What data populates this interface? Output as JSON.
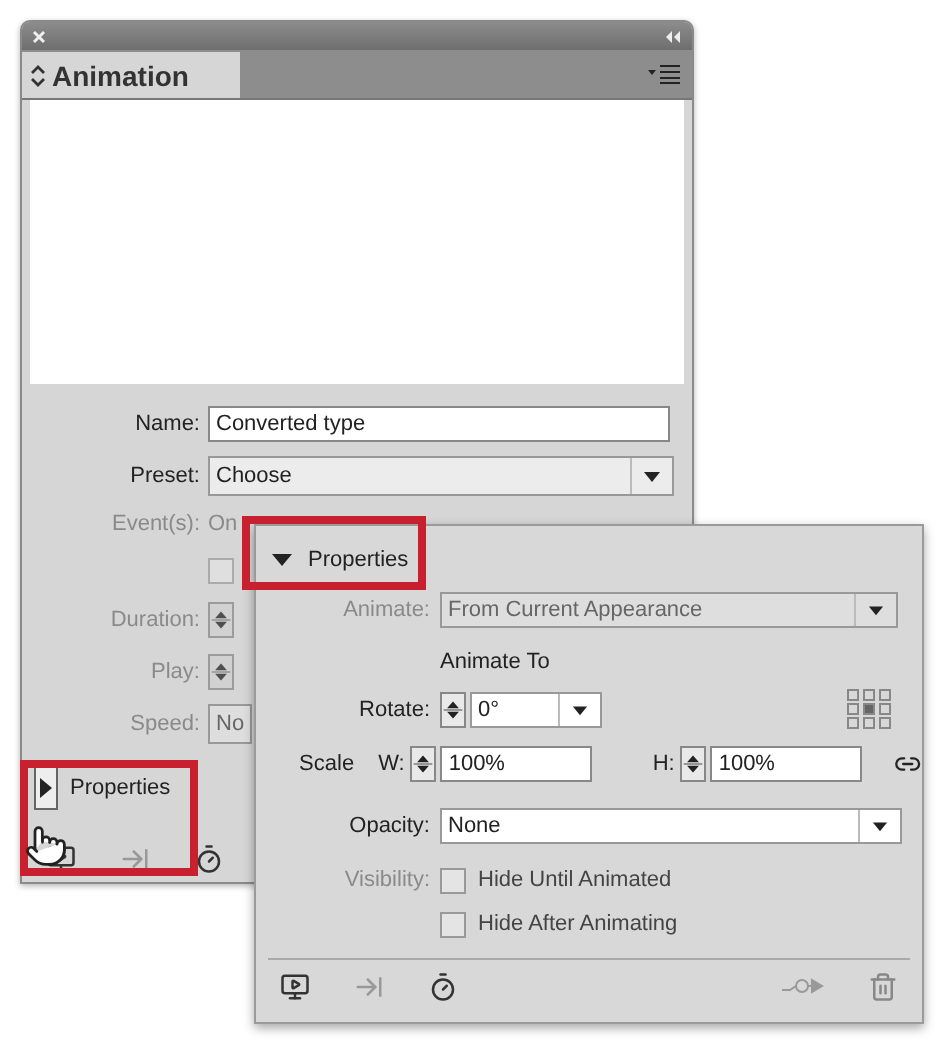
{
  "panel": {
    "title": "Animation",
    "fields": [
      {
        "kind": "text",
        "label": "Name:",
        "value": "Converted type",
        "disabled": false
      },
      {
        "kind": "select",
        "label": "Preset:",
        "value": "Choose",
        "disabled": false
      },
      {
        "kind": "plain",
        "label": "Event(s):",
        "value": "On",
        "disabled": true
      },
      {
        "kind": "checkbox",
        "checked": false,
        "disabled": true
      },
      {
        "kind": "stepper",
        "label": "Duration:",
        "disabled": true
      },
      {
        "kind": "stepper",
        "label": "Play:",
        "disabled": true
      },
      {
        "kind": "select",
        "label": "Speed:",
        "value": "No",
        "disabled": true
      }
    ],
    "properties_toggle": {
      "label": "Properties",
      "expanded": false
    }
  },
  "properties_panel": {
    "label": "Properties",
    "expanded": true,
    "animate": {
      "label": "Animate:",
      "value": "From Current Appearance",
      "disabled": true
    },
    "animate_to": "Animate To",
    "rotate": {
      "label": "Rotate:",
      "value": "0°"
    },
    "scale": {
      "label": "Scale",
      "w_label": "W:",
      "w_value": "100%",
      "h_label": "H:",
      "h_value": "100%"
    },
    "opacity": {
      "label": "Opacity:",
      "value": "None"
    },
    "visibility": {
      "label": "Visibility:",
      "disabled": true,
      "options": [
        {
          "label": "Hide Until Animated",
          "checked": false
        },
        {
          "label": "Hide After Animating",
          "checked": false
        }
      ]
    }
  }
}
